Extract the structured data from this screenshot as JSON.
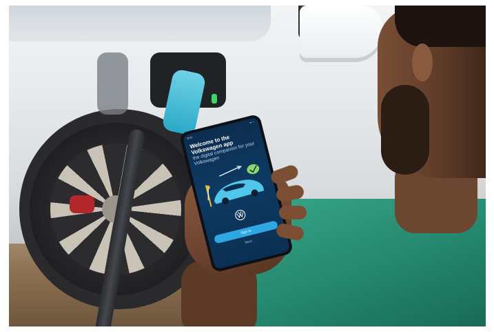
{
  "phone": {
    "status_time": "9:41",
    "status_icons": "▪▪ ◔",
    "welcome_title": "Welcome to the Volkswagen app",
    "welcome_subtitle": "the digital companion for your Volkswagen",
    "primary_button_label": "Sign in",
    "secondary_link_label": "Next"
  },
  "colors": {
    "screen": "#0e3a63",
    "button": "#2fa7e3",
    "shirt": "#23866c",
    "charger_handle": "#2aa9c8",
    "port_led": "#3fd46a"
  },
  "icons": [
    "vw-logo-icon",
    "checkmark-leaf-icon"
  ]
}
